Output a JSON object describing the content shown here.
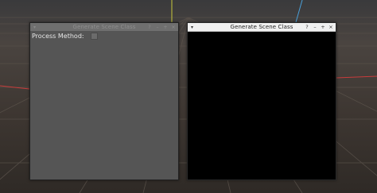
{
  "windows": [
    {
      "title": "Generate Scene Class",
      "menu_glyph": "▾",
      "buttons": {
        "help": "?",
        "minimize": "–",
        "maximize": "+",
        "close": "×"
      },
      "state": "inactive",
      "form": {
        "process_method_label": "Process Method:",
        "process_method_checked": false
      }
    },
    {
      "title": "Generate Scene Class",
      "menu_glyph": "▾",
      "buttons": {
        "help": "?",
        "minimize": "–",
        "maximize": "+",
        "close": "×"
      },
      "state": "active",
      "content": "black"
    }
  ],
  "colors": {
    "background": "#3f3934",
    "grid_line": "#5a524b",
    "axis_x": "#c83c3c",
    "axis_y": "#c8c83c",
    "axis_z": "#4aa0d8",
    "inactive_window": "#555555",
    "active_window_content": "#000000"
  }
}
